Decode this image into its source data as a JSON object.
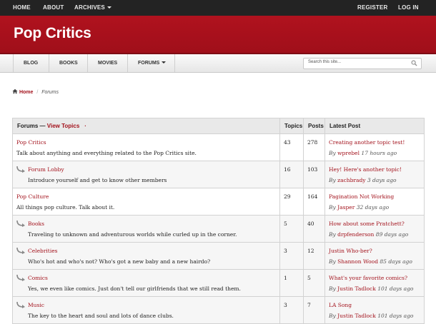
{
  "topnav": {
    "left": [
      "HOME",
      "ABOUT",
      "ARCHIVES"
    ],
    "right": [
      "REGISTER",
      "LOG IN"
    ]
  },
  "site": {
    "title": "Pop Critics"
  },
  "mainnav": [
    "BLOG",
    "BOOKS",
    "MOVIES",
    "FORUMS"
  ],
  "search": {
    "placeholder": "Search this site..."
  },
  "breadcrumb": {
    "home": "Home",
    "sep": "/",
    "current": "Forums"
  },
  "table": {
    "headers": {
      "forums": "Forums —",
      "view_topics": "View Topics",
      "view_topics_mark": "·",
      "topics": "Topics",
      "posts": "Posts",
      "latest": "Latest Post"
    },
    "rows": [
      {
        "name": "Pop Critics",
        "desc": "Talk about anything and everything related to the Pop Critics site.",
        "topics": "43",
        "posts": "278",
        "latest_title": "Creating another topic test!",
        "by": "By",
        "author": "wprebel",
        "ago": "17 hours ago"
      },
      {
        "name": "Forum Lobby",
        "desc": "Introduce yourself and get to know other members",
        "topics": "16",
        "posts": "103",
        "latest_title": "Hey! Here's another topic!",
        "by": "By",
        "author": "zachbrady",
        "ago": "3 days ago"
      },
      {
        "name": "Pop Culture",
        "desc": "All things pop culture. Talk about it.",
        "topics": "29",
        "posts": "164",
        "latest_title": "Pagination Not Working",
        "by": "By",
        "author": "Jasper",
        "ago": "32 days ago"
      },
      {
        "name": "Books",
        "desc": "Traveling to unknown and adventurous worlds while curled up in the corner.",
        "topics": "5",
        "posts": "40",
        "latest_title": "How about some Pratchett?",
        "by": "By",
        "author": "drpfenderson",
        "ago": "89 days ago"
      },
      {
        "name": "Celebrities",
        "desc": "Who's hot and who's not? Who's got a new baby and a new hairdo?",
        "topics": "3",
        "posts": "12",
        "latest_title": "Justin Who-ber?",
        "by": "By",
        "author": "Shannon Wood",
        "ago": "85 days ago"
      },
      {
        "name": "Comics",
        "desc": "Yes, we even like comics. Just don't tell our girlfriends that we still read them.",
        "topics": "1",
        "posts": "5",
        "latest_title": "What's your favorite comics?",
        "by": "By",
        "author": "Justin Tadlock",
        "ago": "101 days ago"
      },
      {
        "name": "Music",
        "desc": "The key to the heart and soul and lots of dance clubs.",
        "topics": "3",
        "posts": "7",
        "latest_title": "LA Song",
        "by": "By",
        "author": "Justin Tadlock",
        "ago": "101 days ago"
      }
    ]
  },
  "colors": {
    "brand": "#a3121c",
    "topbar": "#232323"
  },
  "icons": {
    "home": "home-icon",
    "search": "search-icon",
    "subforum": "subforum-arrow-icon"
  }
}
